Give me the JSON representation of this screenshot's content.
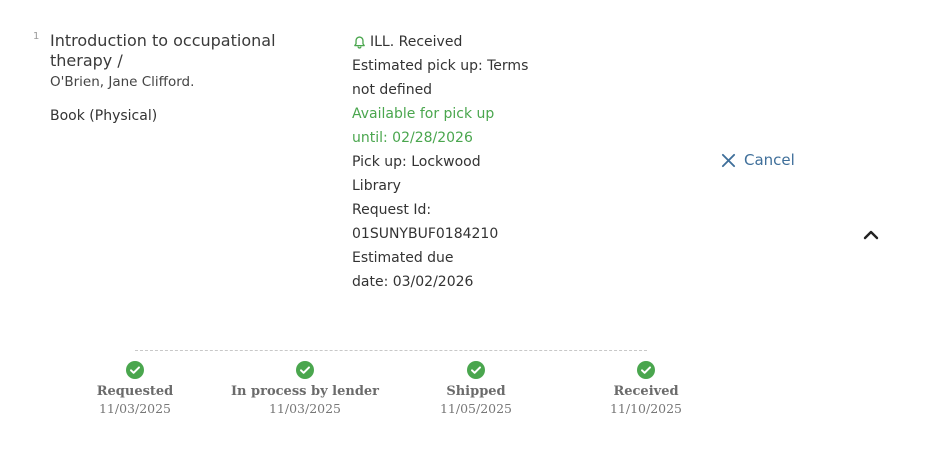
{
  "item": {
    "index": "1",
    "title": "Introduction to occupational therapy /",
    "author": "O'Brien, Jane Clifford.",
    "format": "Book (Physical)"
  },
  "request": {
    "status": "ILL. Received",
    "status_icon": "bell-icon",
    "estimated_pickup": "Estimated pick up: Terms\nnot defined",
    "availability": "Available for pick up\nuntil: 02/28/2026",
    "pickup_location": "Pick up: Lockwood\nLibrary",
    "request_id": "Request Id:\n01SUNYBUF0184210",
    "estimated_due": "Estimated due\ndate: 03/02/2026"
  },
  "actions": {
    "cancel_label": "Cancel",
    "collapse_icon": "chevron-up-icon"
  },
  "tracking": {
    "steps": [
      {
        "label": "Requested",
        "date": "11/03/2025"
      },
      {
        "label": "In process by lender",
        "date": "11/03/2025"
      },
      {
        "label": "Shipped",
        "date": "11/05/2025"
      },
      {
        "label": "Received",
        "date": "11/10/2025"
      }
    ]
  },
  "colors": {
    "accent": "#3f6f9a",
    "success": "#4aa64e"
  }
}
